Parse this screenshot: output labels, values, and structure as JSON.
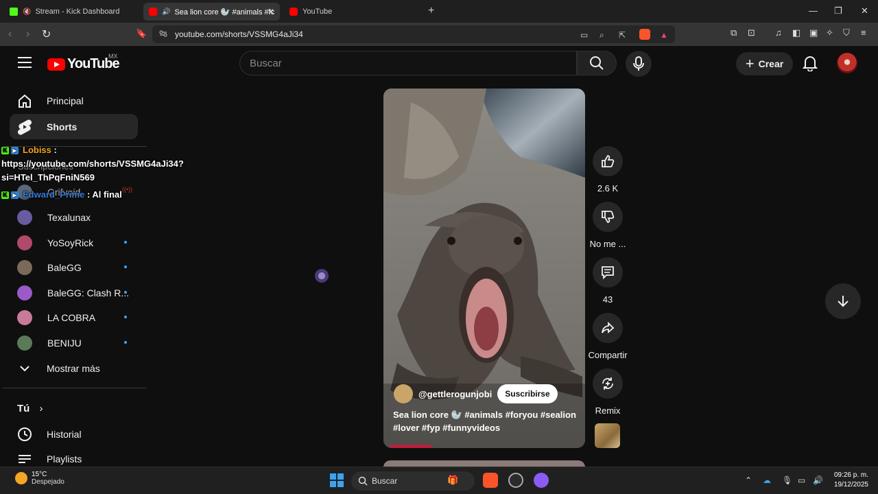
{
  "browser": {
    "tabs": [
      {
        "title": "Stream - Kick Dashboard",
        "active": false
      },
      {
        "title": "Sea lion core 🦭 #animals #fc",
        "active": true
      },
      {
        "title": "YouTube",
        "active": false
      }
    ],
    "url": "youtube.com/shorts/VSSMG4aJi34"
  },
  "youtube": {
    "logo_text": "YouTube",
    "country": "MX",
    "search_placeholder": "Buscar",
    "create_label": "Crear"
  },
  "sidebar": {
    "main": [
      {
        "label": "Principal",
        "icon": "home-icon"
      },
      {
        "label": "Shorts",
        "icon": "shorts-icon",
        "active": true
      }
    ],
    "subscriptions_heading": "Suscripciones",
    "channels": [
      {
        "label": "Grifvoid",
        "color": "#5a6a7a"
      },
      {
        "label": "Texalunax",
        "color": "#6a5aa0"
      },
      {
        "label": "YoSoyRick",
        "color": "#b04a6a"
      },
      {
        "label": "BaleGG",
        "color": "#7a6a5a"
      },
      {
        "label": "BaleGG: Clash R...",
        "color": "#9a5ac8"
      },
      {
        "label": "LA COBRA",
        "color": "#c87a9a"
      },
      {
        "label": "BENIJU",
        "color": "#5a7a5a"
      }
    ],
    "show_more": "Mostrar más",
    "you_heading": "Tú",
    "you_items": [
      {
        "label": "Historial",
        "icon": "history-icon"
      },
      {
        "label": "Playlists",
        "icon": "playlists-icon"
      }
    ]
  },
  "chat": [
    {
      "user": "Lobiss",
      "user_color": "#f5a623",
      "message_lines": [
        "https://youtube.com/shorts/VSSMG4aJi34?",
        "si=HTel_ThPqFniN569"
      ]
    },
    {
      "user": "Edward_Prime",
      "user_color": "#3a7bd5",
      "message": "Al final"
    }
  ],
  "short": {
    "channel": "@gettlerogunjobi",
    "subscribe_label": "Suscribirse",
    "title": "Sea lion core 🦭 #animals #foryou #sealion #lover #fyp #funnyvideos",
    "likes": "2.6 K",
    "dislike_label": "No me ...",
    "comments": "43",
    "share_label": "Compartir",
    "remix_label": "Remix"
  },
  "taskbar": {
    "temperature": "15°C",
    "condition": "Despejado",
    "search_placeholder": "Buscar",
    "time": "09:26 p. m.",
    "date": "19/12/2025"
  },
  "colors": {
    "accent_red": "#ff0000",
    "kick_green": "#53fc18",
    "notification_blue": "#3ea6ff"
  }
}
